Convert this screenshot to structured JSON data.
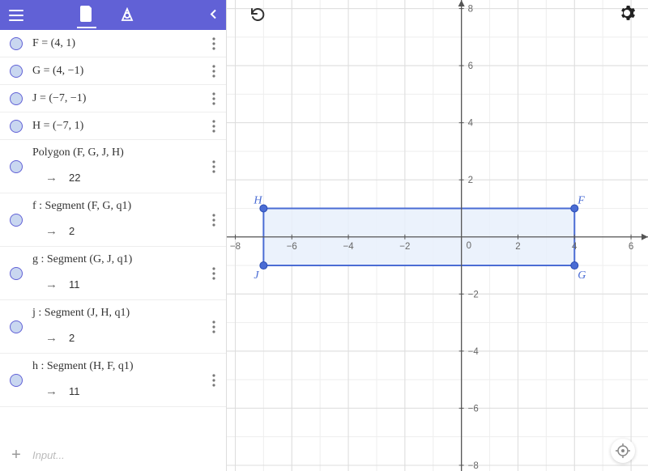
{
  "sidebar": {
    "entries": [
      {
        "type": "point",
        "label": "F = (4, 1)"
      },
      {
        "type": "point",
        "label": "G = (4, −1)"
      },
      {
        "type": "point",
        "label": "J = (−7, −1)"
      },
      {
        "type": "point",
        "label": "H = (−7, 1)"
      },
      {
        "type": "polygon",
        "label": "Polygon (F, G, J, H)",
        "value": "22"
      },
      {
        "type": "segment",
        "label": "f : Segment (F, G, q1)",
        "value": "2"
      },
      {
        "type": "segment",
        "label": "g : Segment (G, J, q1)",
        "value": "11"
      },
      {
        "type": "segment",
        "label": "j : Segment (J, H, q1)",
        "value": "2"
      },
      {
        "type": "segment",
        "label": "h : Segment (H, F, q1)",
        "value": "11"
      }
    ],
    "input_placeholder": "Input..."
  },
  "graph": {
    "x_min": -8.3,
    "x_max": 6.6,
    "y_min": -8.2,
    "y_max": 8.3,
    "points": {
      "F": {
        "x": 4,
        "y": 1
      },
      "G": {
        "x": 4,
        "y": -1
      },
      "J": {
        "x": -7,
        "y": -1
      },
      "H": {
        "x": -7,
        "y": 1
      }
    },
    "polygon": [
      "F",
      "G",
      "J",
      "H"
    ]
  },
  "chart_data": {
    "type": "scatter",
    "title": "",
    "xlabel": "",
    "ylabel": "",
    "xlim": [
      -8.3,
      6.6
    ],
    "ylim": [
      -8.2,
      8.3
    ],
    "grid": true,
    "series": [
      {
        "name": "F",
        "x": [
          4
        ],
        "y": [
          1
        ]
      },
      {
        "name": "G",
        "x": [
          4
        ],
        "y": [
          -1
        ]
      },
      {
        "name": "J",
        "x": [
          -7
        ],
        "y": [
          -1
        ]
      },
      {
        "name": "H",
        "x": [
          -7
        ],
        "y": [
          1
        ]
      }
    ],
    "shapes": [
      {
        "type": "polygon",
        "vertices": [
          [
            4,
            1
          ],
          [
            4,
            -1
          ],
          [
            -7,
            -1
          ],
          [
            -7,
            1
          ]
        ],
        "fill": "#e8f0fb",
        "stroke": "#4a6cd4"
      }
    ],
    "derived": {
      "polygon_perimeter": 22,
      "segments": {
        "f_FG": 2,
        "g_GJ": 11,
        "j_JH": 2,
        "h_HF": 11
      }
    }
  }
}
